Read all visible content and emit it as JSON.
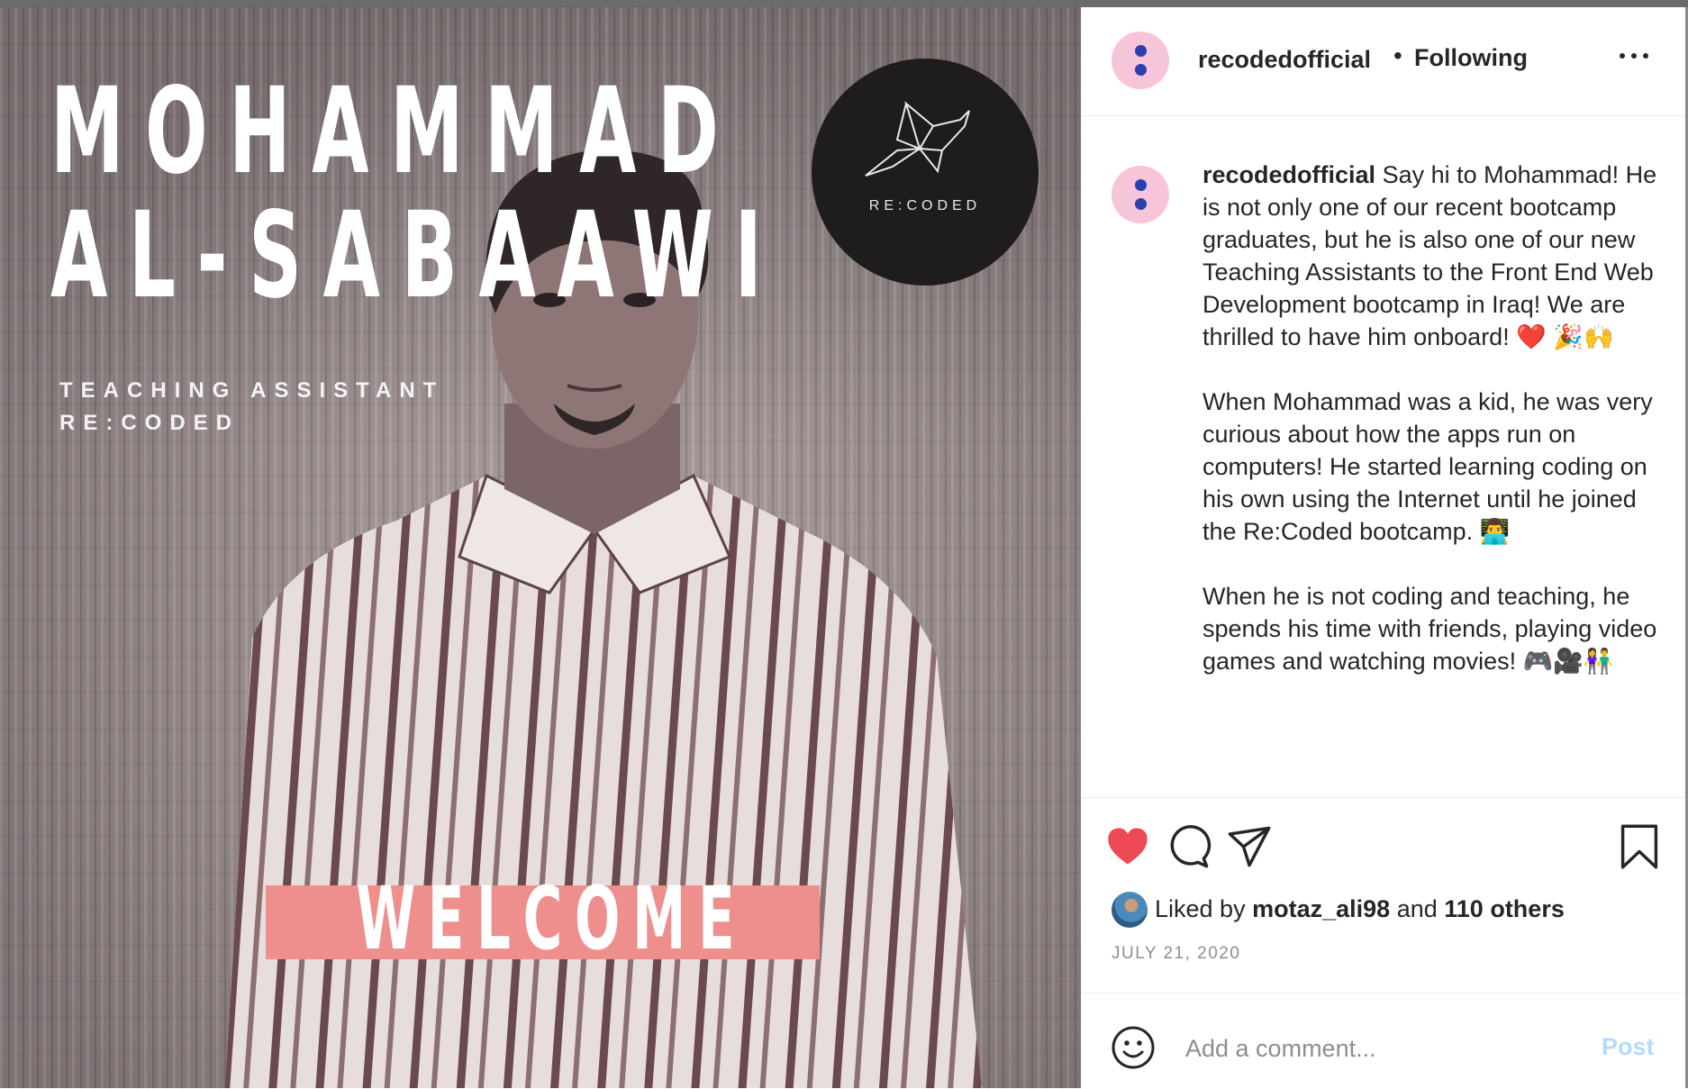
{
  "photo": {
    "name_line1": "MOHAMMAD",
    "name_line2": "AL-SABAAWI",
    "role_line1": "TEACHING ASSISTANT",
    "role_line2": "RE:CODED",
    "brand_text": "RE:CODED",
    "welcome_text": "WELCOME",
    "welcome_color": "#ee8e8d"
  },
  "header": {
    "username": "recodedofficial",
    "separator": "•",
    "follow_status": "Following",
    "more_icon": "more-horizontal-icon",
    "avatar_color": "#f7c5d9"
  },
  "caption": {
    "username": "recodedofficial",
    "paragraph1": "Say hi to Mohammad! He is not only one of our recent bootcamp graduates, but he is also one of our new Teaching Assistants to the Front End Web Development bootcamp in Iraq! We are thrilled to have him onboard! ❤️ 🎉🙌",
    "paragraph2": "When Mohammad was a kid, he was very curious about how the apps run on computers! He started learning coding on his own using the Internet until he joined the Re:Coded bootcamp. 👨‍💻",
    "paragraph3": "When he is not coding and teaching, he spends his time with friends, playing video games and watching movies! 🎮🎥👫"
  },
  "actions": {
    "like_icon": "heart-icon",
    "comment_icon": "comment-icon",
    "share_icon": "share-icon",
    "save_icon": "bookmark-icon",
    "like_color": "#ed4956"
  },
  "likes": {
    "prefix": "Liked by",
    "user": "motaz_ali98",
    "conjunction": "and",
    "others": "110 others"
  },
  "date": "JULY 21, 2020",
  "comment": {
    "placeholder": "Add a comment...",
    "post_label": "Post",
    "emoji_icon": "smiley-icon"
  }
}
